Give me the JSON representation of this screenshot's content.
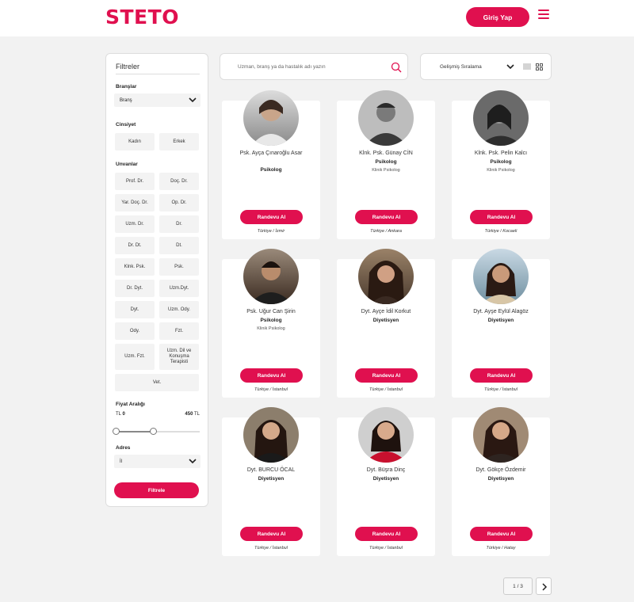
{
  "header": {
    "logo": "STETO",
    "login_label": "Giriş Yap"
  },
  "filters": {
    "title": "Filtreler",
    "branches": {
      "label": "Branşlar",
      "selected": "Branş"
    },
    "gender": {
      "label": "Cinsiyet",
      "options": [
        "Kadın",
        "Erkek"
      ]
    },
    "titles": {
      "label": "Unvanlar",
      "options": [
        "Prof. Dr.",
        "Doç. Dr.",
        "Yar. Doç. Dr.",
        "Op. Dr.",
        "Uzm. Dr.",
        "Dr.",
        "Dr. Dt.",
        "Dt.",
        "Klnk. Psk.",
        "Psk.",
        "Dr. Dyt.",
        "Uzm.Dyt.",
        "Dyt.",
        "Uzm. Ody.",
        "Ody.",
        "Fzt.",
        "Uzm. Fzt.",
        "Uzm. Dil ve Konuşma Terapisti",
        "Vet."
      ]
    },
    "price": {
      "label": "Fiyat Aralığı",
      "min_currency": "TL",
      "min": "0",
      "max": "450",
      "max_currency": "TL"
    },
    "address": {
      "label": "Adres",
      "selected": "İl"
    },
    "filter_button": "Filtrele"
  },
  "search": {
    "placeholder": "Uzman, branş ya da hastalık adı yazın"
  },
  "sort": {
    "selected": "Gelişmiş Sıralama"
  },
  "experts": [
    {
      "name": "Psk. Ayça Çınaroğlu Asar",
      "title": "Psikolog",
      "subtitle": "",
      "book_label": "Randevu Al",
      "location": "Türkiye / İzmir"
    },
    {
      "name": "Klnk. Psk. Günay CİN",
      "title": "Psikolog",
      "subtitle": "Klinik Psikolog",
      "book_label": "Randevu Al",
      "location": "Türkiye / Ankara"
    },
    {
      "name": "Klnk. Psk. Pelin Kalcı",
      "title": "Psikolog",
      "subtitle": "Klinik Psikolog",
      "book_label": "Randevu Al",
      "location": "Türkiye / Kocaeli"
    },
    {
      "name": "Psk. Uğur Can Şirin",
      "title": "Psikolog",
      "subtitle": "Klinik Psikolog",
      "book_label": "Randevu Al",
      "location": "Türkiye / İstanbul"
    },
    {
      "name": "Dyt. Ayçe İdil Korkut",
      "title": "Diyetisyen",
      "subtitle": "",
      "book_label": "Randevu Al",
      "location": "Türkiye / İstanbul"
    },
    {
      "name": "Dyt. Ayşe Eylül Alagöz",
      "title": "Diyetisyen",
      "subtitle": "",
      "book_label": "Randevu Al",
      "location": "Türkiye / İstanbul"
    },
    {
      "name": "Dyt. BURCU ÖCAL",
      "title": "Diyetisyen",
      "subtitle": "",
      "book_label": "Randevu Al",
      "location": "Türkiye / İstanbul"
    },
    {
      "name": "Dyt. Büşra Dinç",
      "title": "Diyetisyen",
      "subtitle": "",
      "book_label": "Randevu Al",
      "location": "Türkiye / İstanbul"
    },
    {
      "name": "Dyt. Gökçe Özdemir",
      "title": "Diyetisyen",
      "subtitle": "",
      "book_label": "Randevu Al",
      "location": "Türkiye / Hatay"
    }
  ],
  "pagination": {
    "label": "1 / 3"
  },
  "colors": {
    "brand": "#e0104f",
    "background": "#f2f2f2"
  }
}
